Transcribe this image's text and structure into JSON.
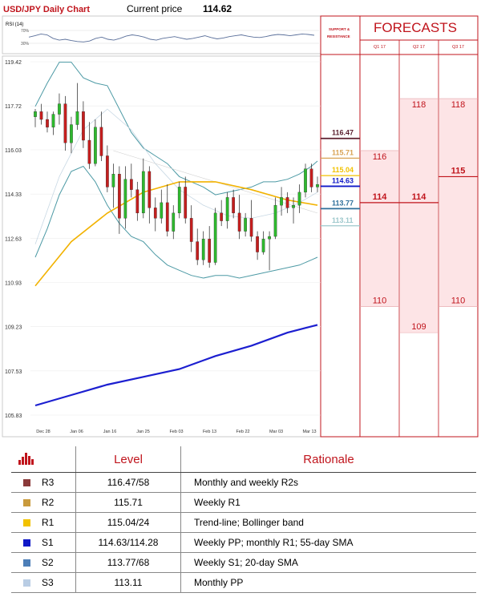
{
  "header": {
    "title": "USD/JPY Daily Chart",
    "price_label": "Current price",
    "price_value": "114.62"
  },
  "rsi": {
    "label": "RSI (14)",
    "levels": [
      "70%",
      "30%"
    ]
  },
  "chart_data": [
    {
      "type": "candlestick",
      "title": "USD/JPY Daily Chart",
      "ylim": [
        105.83,
        119.42
      ],
      "y_ticks": [
        "119.42",
        "117.72",
        "116.03",
        "114.33",
        "112.63",
        "110.93",
        "109.23",
        "107.53",
        "105.83"
      ],
      "x_ticks": [
        "Dec 28",
        "Jan 06",
        "Jan 16",
        "Jan 25",
        "Feb 03",
        "Feb 13",
        "Feb 22",
        "Mar 03",
        "Mar 13"
      ],
      "candles": [
        [
          117.3,
          117.6,
          116.9,
          117.5
        ],
        [
          117.5,
          117.8,
          117.0,
          117.2
        ],
        [
          117.2,
          117.5,
          116.7,
          116.9
        ],
        [
          116.9,
          117.5,
          116.6,
          117.4
        ],
        [
          117.4,
          118.2,
          117.0,
          117.8
        ],
        [
          117.8,
          118.1,
          116.0,
          116.3
        ],
        [
          116.3,
          117.3,
          115.9,
          117.0
        ],
        [
          117.0,
          118.6,
          116.8,
          117.5
        ],
        [
          117.5,
          117.9,
          116.1,
          116.4
        ],
        [
          116.4,
          117.1,
          115.3,
          115.5
        ],
        [
          115.5,
          117.2,
          115.4,
          116.9
        ],
        [
          116.9,
          117.5,
          115.6,
          115.8
        ],
        [
          115.8,
          116.2,
          114.4,
          114.6
        ],
        [
          114.6,
          115.5,
          113.8,
          115.1
        ],
        [
          115.1,
          115.4,
          112.8,
          113.4
        ],
        [
          113.4,
          115.4,
          113.0,
          114.9
        ],
        [
          114.9,
          115.5,
          114.2,
          114.5
        ],
        [
          114.5,
          114.8,
          113.3,
          113.6
        ],
        [
          113.6,
          115.7,
          113.4,
          115.2
        ],
        [
          115.2,
          115.4,
          113.2,
          113.8
        ],
        [
          113.8,
          114.2,
          112.9,
          113.4
        ],
        [
          113.4,
          114.5,
          113.2,
          114.0
        ],
        [
          114.0,
          114.7,
          112.7,
          112.9
        ],
        [
          112.9,
          113.9,
          112.6,
          113.6
        ],
        [
          113.6,
          114.8,
          113.4,
          114.6
        ],
        [
          114.6,
          115.0,
          113.2,
          113.4
        ],
        [
          113.4,
          113.9,
          112.1,
          112.5
        ],
        [
          112.5,
          113.0,
          111.6,
          111.8
        ],
        [
          111.8,
          112.9,
          111.6,
          112.6
        ],
        [
          112.6,
          113.1,
          111.5,
          111.7
        ],
        [
          111.7,
          113.8,
          111.6,
          113.6
        ],
        [
          113.6,
          114.1,
          113.1,
          113.3
        ],
        [
          113.3,
          114.4,
          113.0,
          114.2
        ],
        [
          114.2,
          114.5,
          113.4,
          113.6
        ],
        [
          113.6,
          114.3,
          112.6,
          112.9
        ],
        [
          112.9,
          113.6,
          112.7,
          113.4
        ],
        [
          113.4,
          114.1,
          112.5,
          112.7
        ],
        [
          112.7,
          112.9,
          111.8,
          112.1
        ],
        [
          112.1,
          112.9,
          112.0,
          112.6
        ],
        [
          112.6,
          112.9,
          111.4,
          112.7
        ],
        [
          112.7,
          114.2,
          112.6,
          113.9
        ],
        [
          113.9,
          114.6,
          113.5,
          114.2
        ],
        [
          114.2,
          114.4,
          113.6,
          113.8
        ],
        [
          113.8,
          114.2,
          113.2,
          113.9
        ],
        [
          113.9,
          114.7,
          113.6,
          114.4
        ],
        [
          114.4,
          115.5,
          114.2,
          115.3
        ],
        [
          115.3,
          115.5,
          114.4,
          114.6
        ],
        [
          114.6,
          115.0,
          114.4,
          114.7
        ]
      ],
      "sma_20": [
        [
          0,
          112.4
        ],
        [
          4,
          115.0
        ],
        [
          8,
          116.8
        ],
        [
          12,
          117.6
        ],
        [
          16,
          116.8
        ],
        [
          20,
          115.5
        ],
        [
          24,
          114.5
        ],
        [
          28,
          113.9
        ],
        [
          32,
          113.5
        ],
        [
          36,
          113.4
        ],
        [
          40,
          113.6
        ],
        [
          44,
          114.0
        ],
        [
          47,
          114.4
        ]
      ],
      "bollinger_upper": [
        [
          0,
          117.7
        ],
        [
          2,
          118.6
        ],
        [
          4,
          119.4
        ],
        [
          6,
          119.4
        ],
        [
          8,
          118.8
        ],
        [
          10,
          118.6
        ],
        [
          12,
          118.5
        ],
        [
          14,
          117.6
        ],
        [
          16,
          116.7
        ],
        [
          18,
          116.1
        ],
        [
          20,
          115.8
        ],
        [
          22,
          115.5
        ],
        [
          24,
          115.0
        ],
        [
          26,
          114.8
        ],
        [
          28,
          114.6
        ],
        [
          30,
          114.3
        ],
        [
          32,
          114.4
        ],
        [
          34,
          114.5
        ],
        [
          36,
          114.6
        ],
        [
          38,
          114.8
        ],
        [
          40,
          114.8
        ],
        [
          42,
          114.9
        ],
        [
          44,
          115.1
        ],
        [
          46,
          115.4
        ],
        [
          47,
          115.6
        ]
      ],
      "bollinger_lower": [
        [
          0,
          111.9
        ],
        [
          2,
          113.0
        ],
        [
          4,
          114.3
        ],
        [
          6,
          115.2
        ],
        [
          8,
          115.4
        ],
        [
          10,
          114.8
        ],
        [
          12,
          113.9
        ],
        [
          14,
          113.2
        ],
        [
          16,
          112.7
        ],
        [
          18,
          112.5
        ],
        [
          20,
          112.0
        ],
        [
          22,
          111.6
        ],
        [
          24,
          111.4
        ],
        [
          26,
          111.2
        ],
        [
          28,
          111.1
        ],
        [
          30,
          111.2
        ],
        [
          32,
          111.2
        ],
        [
          34,
          111.1
        ],
        [
          36,
          111.2
        ],
        [
          38,
          111.3
        ],
        [
          40,
          111.4
        ],
        [
          42,
          111.5
        ],
        [
          44,
          111.6
        ],
        [
          46,
          111.8
        ],
        [
          47,
          111.9
        ]
      ],
      "sma_55": [
        [
          0,
          110.8
        ],
        [
          6,
          112.5
        ],
        [
          12,
          113.6
        ],
        [
          18,
          114.4
        ],
        [
          24,
          114.8
        ],
        [
          30,
          114.8
        ],
        [
          36,
          114.5
        ],
        [
          42,
          114.1
        ],
        [
          47,
          113.9
        ]
      ],
      "sma_200": [
        [
          0,
          106.2
        ],
        [
          6,
          106.6
        ],
        [
          12,
          107.0
        ],
        [
          18,
          107.3
        ],
        [
          24,
          107.6
        ],
        [
          30,
          108.1
        ],
        [
          36,
          108.5
        ],
        [
          42,
          109.0
        ],
        [
          47,
          109.3
        ]
      ],
      "trendline": [
        [
          13,
          116.0
        ],
        [
          47,
          113.6
        ]
      ]
    }
  ],
  "support_resistance": {
    "title_line1": "SUPPORT &",
    "title_line2": "RESISTANCE",
    "levels": [
      {
        "value": 116.47,
        "label": "116.47",
        "color": "#5b1f2e"
      },
      {
        "value": 115.71,
        "label": "115.71",
        "color": "#d8a355"
      },
      {
        "value": 115.04,
        "label": "115.04",
        "color": "#f2c200"
      },
      {
        "value": 114.63,
        "label": "114.63",
        "color": "#1019c8"
      },
      {
        "value": 113.77,
        "label": "113.77",
        "color": "#2e6f9a"
      },
      {
        "value": 113.11,
        "label": "113.11",
        "color": "#9dc8cc"
      }
    ]
  },
  "forecasts": {
    "title": "FORECASTS",
    "columns": [
      {
        "label": "Q1 17",
        "high": "116",
        "mid": "114",
        "low": "110",
        "high_value": 116,
        "mid_value": 114,
        "low_value": 110
      },
      {
        "label": "Q2 17",
        "high": "118",
        "mid": "114",
        "low": "109",
        "high_value": 118,
        "mid_value": 114,
        "low_value": 109
      },
      {
        "label": "Q3 17",
        "high": "118",
        "mid": "115",
        "low": "110",
        "high_value": 118,
        "mid_value": 115,
        "low_value": 110
      }
    ]
  },
  "table": {
    "headers": [
      "Level",
      "Rationale"
    ],
    "rows": [
      {
        "name": "R3",
        "level": "116.47/58",
        "rationale": "Monthly and weekly R2s",
        "color": "#8b3a3a"
      },
      {
        "name": "R2",
        "level": "115.71",
        "rationale": "Weekly R1",
        "color": "#c99a3c"
      },
      {
        "name": "R1",
        "level": "115.04/24",
        "rationale": "Trend-line; Bollinger band",
        "color": "#f2c200"
      },
      {
        "name": "S1",
        "level": "114.63/114.28",
        "rationale": "Weekly PP; monthly R1; 55-day SMA",
        "color": "#1019c8"
      },
      {
        "name": "S2",
        "level": "113.77/68",
        "rationale": "Weekly S1; 20-day SMA",
        "color": "#4d7fb8"
      },
      {
        "name": "S3",
        "level": "113.11",
        "rationale": "Monthly PP",
        "color": "#b9cde4"
      }
    ]
  }
}
